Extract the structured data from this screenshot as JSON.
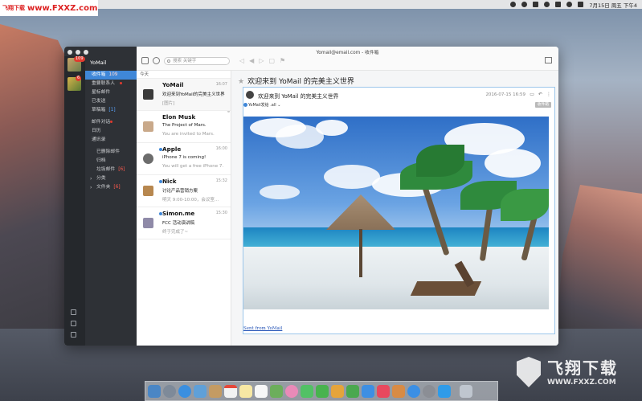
{
  "brand": {
    "prefix": "飞翔下载",
    "url": "www.FXXZ.com"
  },
  "menubar": {
    "datetime": "7月15日 周五 下午4"
  },
  "window": {
    "title": "Yomail@email.com - 收件箱"
  },
  "account": {
    "name": "YoMail",
    "badge": "109",
    "second_badge": "6"
  },
  "folders": [
    {
      "label": "收件箱",
      "count": "109",
      "active": true
    },
    {
      "label": "重要联系人",
      "count": "",
      "active": false
    },
    {
      "label": "星标邮件",
      "count": "",
      "active": false
    },
    {
      "label": "已发送",
      "count": "",
      "active": false
    },
    {
      "label": "草稿箱",
      "count": "[1]",
      "active": false
    }
  ],
  "folders2": [
    {
      "label": "邮件对话"
    },
    {
      "label": "日历"
    },
    {
      "label": "通讯录"
    }
  ],
  "folders3": [
    {
      "label": "已删除邮件",
      "count": ""
    },
    {
      "label": "归档",
      "count": ""
    },
    {
      "label": "垃圾邮件",
      "count": "[6]"
    },
    {
      "label": "分类",
      "count": ""
    },
    {
      "label": "文件夹",
      "count": "[6]"
    }
  ],
  "toolbar": {
    "search_placeholder": "搜索 关键字"
  },
  "list": {
    "header": "今天",
    "mails": [
      {
        "sender": "YoMail",
        "time": "16:07",
        "subject": "欢迎来到YoMail的完美主义世界",
        "preview": "[图片]"
      },
      {
        "sender": "Elon Musk",
        "time": "",
        "subject": "The Project of Mars.",
        "preview": "You are invited to Mars."
      },
      {
        "sender": "Apple",
        "time": "16:00",
        "subject": "iPhone 7 is coming!",
        "preview": "You will get a free iPhone 7."
      },
      {
        "sender": "Nick",
        "time": "15:32",
        "subject": "讨论产品营销方案",
        "preview": "明天 9:00-10:00，会议室..."
      },
      {
        "sender": "Simon.me",
        "time": "15:30",
        "subject": "FCC 活动演讲稿",
        "preview": "终于完成了~"
      }
    ]
  },
  "reader": {
    "title": "欢迎来到 YoMail 的完美主义世界",
    "subject": "欢迎来到 YoMail 的完美主义世界",
    "date": "2016-07-15 16:59",
    "tag": "收件箱",
    "from": "YoMail发给 .all",
    "link": "Sent from YoMail"
  },
  "watermark": {
    "cn": "飞翔下载",
    "url": "WWW.FXXZ.COM"
  }
}
